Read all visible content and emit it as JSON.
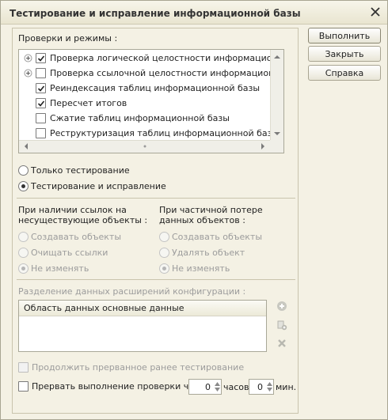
{
  "window": {
    "title": "Тестирование и исправление информационной базы"
  },
  "checks": {
    "label": "Проверки и режимы :",
    "items": [
      {
        "label": "Проверка логической целостности информационной базы",
        "checked": true,
        "expandable": true
      },
      {
        "label": "Проверка ссылочной целостности информационной базы",
        "checked": false,
        "expandable": true
      },
      {
        "label": "Реиндексация таблиц информационной базы",
        "checked": true,
        "expandable": false
      },
      {
        "label": "Пересчет итогов",
        "checked": true,
        "expandable": false
      },
      {
        "label": "Сжатие таблиц информационной базы",
        "checked": false,
        "expandable": false
      },
      {
        "label": "Реструктуризация таблиц информационной базы",
        "checked": false,
        "expandable": false
      }
    ]
  },
  "mode": {
    "options": [
      {
        "label": "Только тестирование",
        "selected": false
      },
      {
        "label": "Тестирование и исправление",
        "selected": true
      }
    ]
  },
  "missing_refs": {
    "label_line1": "При наличии ссылок на",
    "label_line2": "несуществующие объекты :",
    "options": [
      {
        "label": "Создавать объекты",
        "selected": false
      },
      {
        "label": "Очищать ссылки",
        "selected": false
      },
      {
        "label": "Не изменять",
        "selected": true
      }
    ]
  },
  "partial_loss": {
    "label_line1": "При частичной потере",
    "label_line2": "данных объектов :",
    "options": [
      {
        "label": "Создавать объекты",
        "selected": false
      },
      {
        "label": "Удалять объект",
        "selected": false
      },
      {
        "label": "Не изменять",
        "selected": true
      }
    ]
  },
  "extensions": {
    "label": "Разделение данных расширений конфигурации :",
    "column_header": "Область данных основные данные"
  },
  "resume": {
    "label": "Продолжить прерванное ранее тестирование",
    "checked": false
  },
  "interrupt": {
    "label": "Прервать выполнение проверки через",
    "checked": false,
    "hours_value": "0",
    "hours_unit": "часов",
    "minutes_value": "0",
    "minutes_unit": "мин."
  },
  "buttons": {
    "run": "Выполнить",
    "close": "Закрыть",
    "help": "Справка"
  },
  "icons": {
    "close": "close-icon",
    "expand": "plus-icon",
    "add": "add-icon",
    "copy": "copy-icon",
    "delete": "delete-icon"
  },
  "colors": {
    "background": "#f4f1e4",
    "disabled_text": "#9c9c9c",
    "title_text": "#333333"
  }
}
